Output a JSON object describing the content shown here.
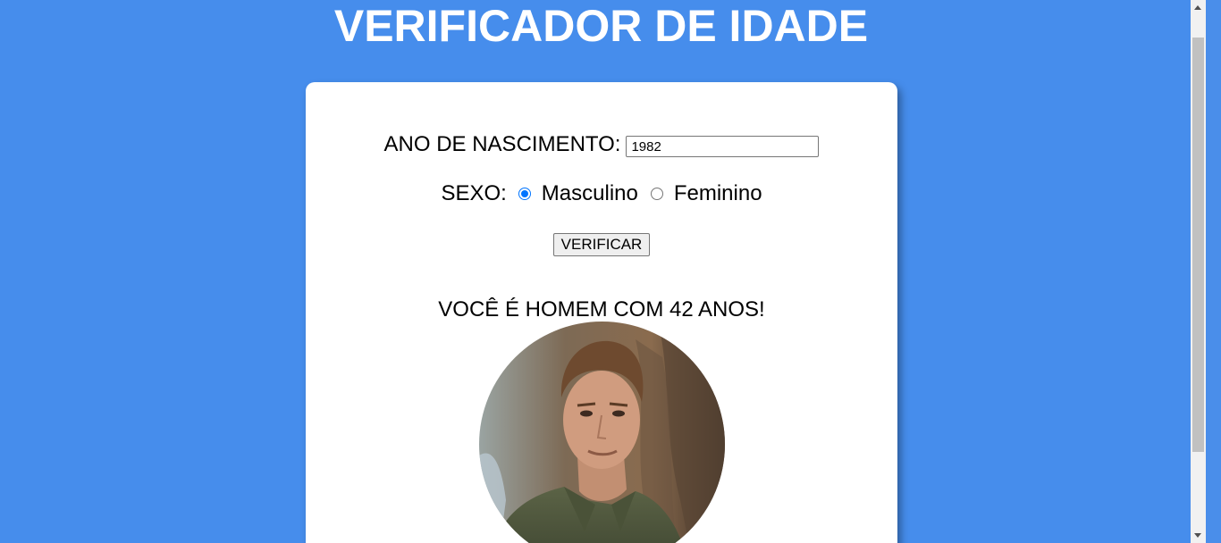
{
  "title": "VERIFICADOR DE IDADE",
  "form": {
    "year_label": "ANO DE NASCIMENTO:",
    "year_value": "1982",
    "sex_label": "SEXO:",
    "sex_options": [
      {
        "label": "Masculino",
        "checked": true
      },
      {
        "label": "Feminino",
        "checked": false
      }
    ],
    "button_label": "VERIFICAR"
  },
  "result": {
    "text": "VOCÊ É HOMEM COM 42 ANOS!",
    "photo": "man-portrait"
  },
  "colors": {
    "background": "#468dec",
    "card": "#ffffff",
    "radio_accent": "#0075ff"
  }
}
